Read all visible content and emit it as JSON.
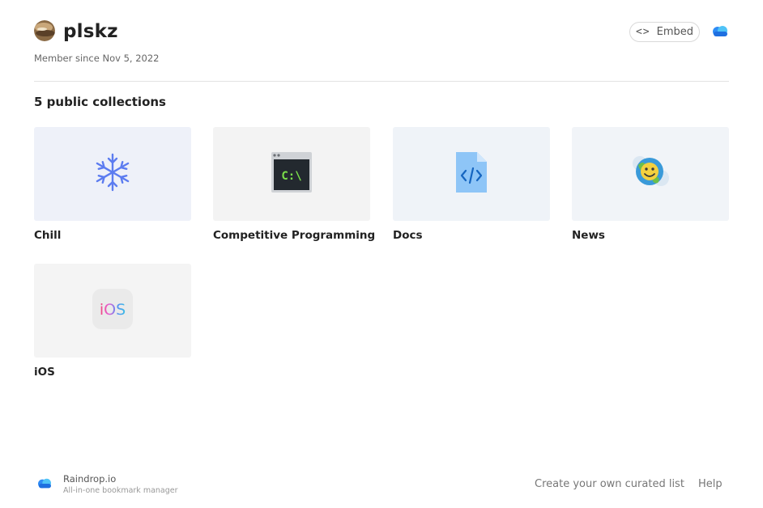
{
  "profile": {
    "username": "plskz",
    "member_since": "Member since Nov 5, 2022"
  },
  "header": {
    "embed_label": "Embed"
  },
  "collections": {
    "heading": "5 public collections",
    "items": [
      {
        "title": "Chill",
        "icon": "snowflake-icon"
      },
      {
        "title": "Competitive Programming",
        "icon": "terminal-icon"
      },
      {
        "title": "Docs",
        "icon": "code-document-icon"
      },
      {
        "title": "News",
        "icon": "globe-emoji-icon"
      },
      {
        "title": "iOS",
        "icon": "ios-icon",
        "icon_text": "iOS"
      }
    ]
  },
  "footer": {
    "brand": "Raindrop.io",
    "tagline": "All-in-one bookmark manager",
    "create_link": "Create your own curated list",
    "help_link": "Help"
  },
  "colors": {
    "accent": "#1e88e5",
    "card_bg": "#f1f4f8",
    "snowflake": "#5c7cf0",
    "terminal_green": "#7be04a"
  }
}
